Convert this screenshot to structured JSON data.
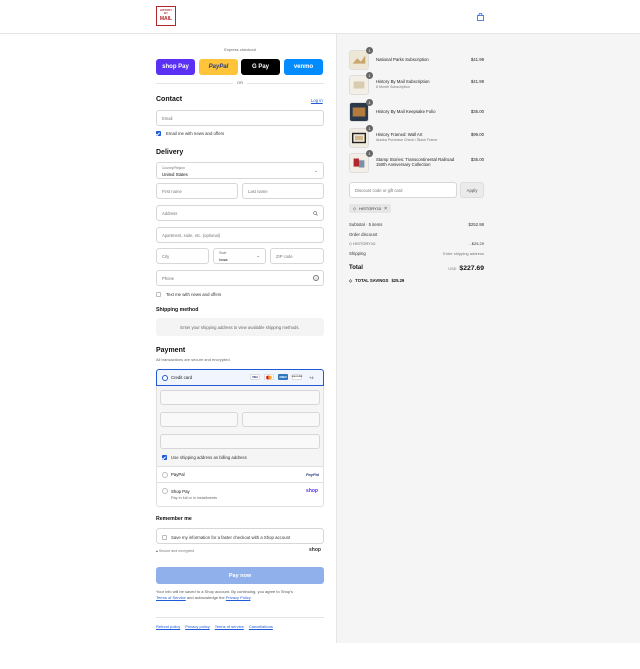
{
  "header": {
    "logo_line1": "HISTORY",
    "logo_line2": "BY",
    "logo_line3": "MAIL"
  },
  "express": {
    "label": "Express checkout",
    "or": "OR",
    "buttons": [
      "shop Pay",
      "PayPal",
      "G Pay",
      "venmo"
    ]
  },
  "contact": {
    "heading": "Contact",
    "login": "Log in",
    "email_placeholder": "Email",
    "email_news_label": "Email me with news and offers"
  },
  "delivery": {
    "heading": "Delivery",
    "country_label": "Country/Region",
    "country_value": "United States",
    "first_name": "First name",
    "last_name": "Last name",
    "address": "Address",
    "apartment": "Apartment, suite, etc. (optional)",
    "city": "City",
    "state_label": "State",
    "state_value": "Iowa",
    "zip": "ZIP code",
    "phone": "Phone",
    "text_news_label": "Text me with news and offers"
  },
  "shipping": {
    "heading": "Shipping method",
    "notice": "Enter your shipping address to view available shipping methods."
  },
  "payment": {
    "heading": "Payment",
    "secure_note": "All transactions are secure and encrypted.",
    "credit_card_label": "Credit card",
    "cards": [
      "VISA",
      "MC",
      "AMEX",
      "DISCOVER"
    ],
    "more_cards": "+4",
    "billing_label": "Use shipping address as billing address",
    "paypal_label": "PayPal",
    "paypal_logo": "PayPal",
    "shoppay_label": "Shop Pay",
    "shoppay_sub": "Pay in full or in installments",
    "shoppay_logo": "shop"
  },
  "remember": {
    "heading": "Remember me",
    "save_label": "Save my information for a faster checkout with a Shop account",
    "secure_label": "Secure and encrypted",
    "shop_logo": "shop"
  },
  "paynow": "Pay now",
  "legal": {
    "text1": "Your info will be saved to a Shop account. By continuing, you agree to Shop's",
    "tos": "Terms of Service",
    "text2": "and acknowledge the",
    "privacy": "Privacy Policy",
    "end": "."
  },
  "footer_links": [
    "Refund policy",
    "Privacy policy",
    "Terms of service",
    "Cancellations"
  ],
  "cart": {
    "items": [
      {
        "qty": "1",
        "name": "National Parks Subscription",
        "sub": "",
        "price": "$41.99"
      },
      {
        "qty": "1",
        "name": "History By Mail Subscription",
        "sub": "6 Month Subscription",
        "price": "$41.99"
      },
      {
        "qty": "1",
        "name": "History By Mail Keepsake Folio",
        "sub": "",
        "price": "$35.00"
      },
      {
        "qty": "1",
        "name": "History Framed: Wall Art",
        "sub": "Alaska Purchase Check / Black Frame",
        "price": "$99.00"
      },
      {
        "qty": "1",
        "name": "Stamp Stories: Transcontinental Railroad 150th Anniversary Collection",
        "sub": "",
        "price": "$35.00"
      }
    ],
    "discount_placeholder": "Discount code or gift card",
    "apply": "Apply",
    "applied_code": "HISTORY10",
    "subtotal_label": "Subtotal · 5 items",
    "subtotal_value": "$252.98",
    "order_discount_label": "Order discount",
    "discount_code": "HISTORY10",
    "discount_value": "- $25.29",
    "shipping_label": "Shipping",
    "shipping_value": "Enter shipping address",
    "total_label": "Total",
    "currency": "USD",
    "total_value": "$227.69",
    "savings_label": "TOTAL SAVINGS",
    "savings_value": "$25.29"
  }
}
